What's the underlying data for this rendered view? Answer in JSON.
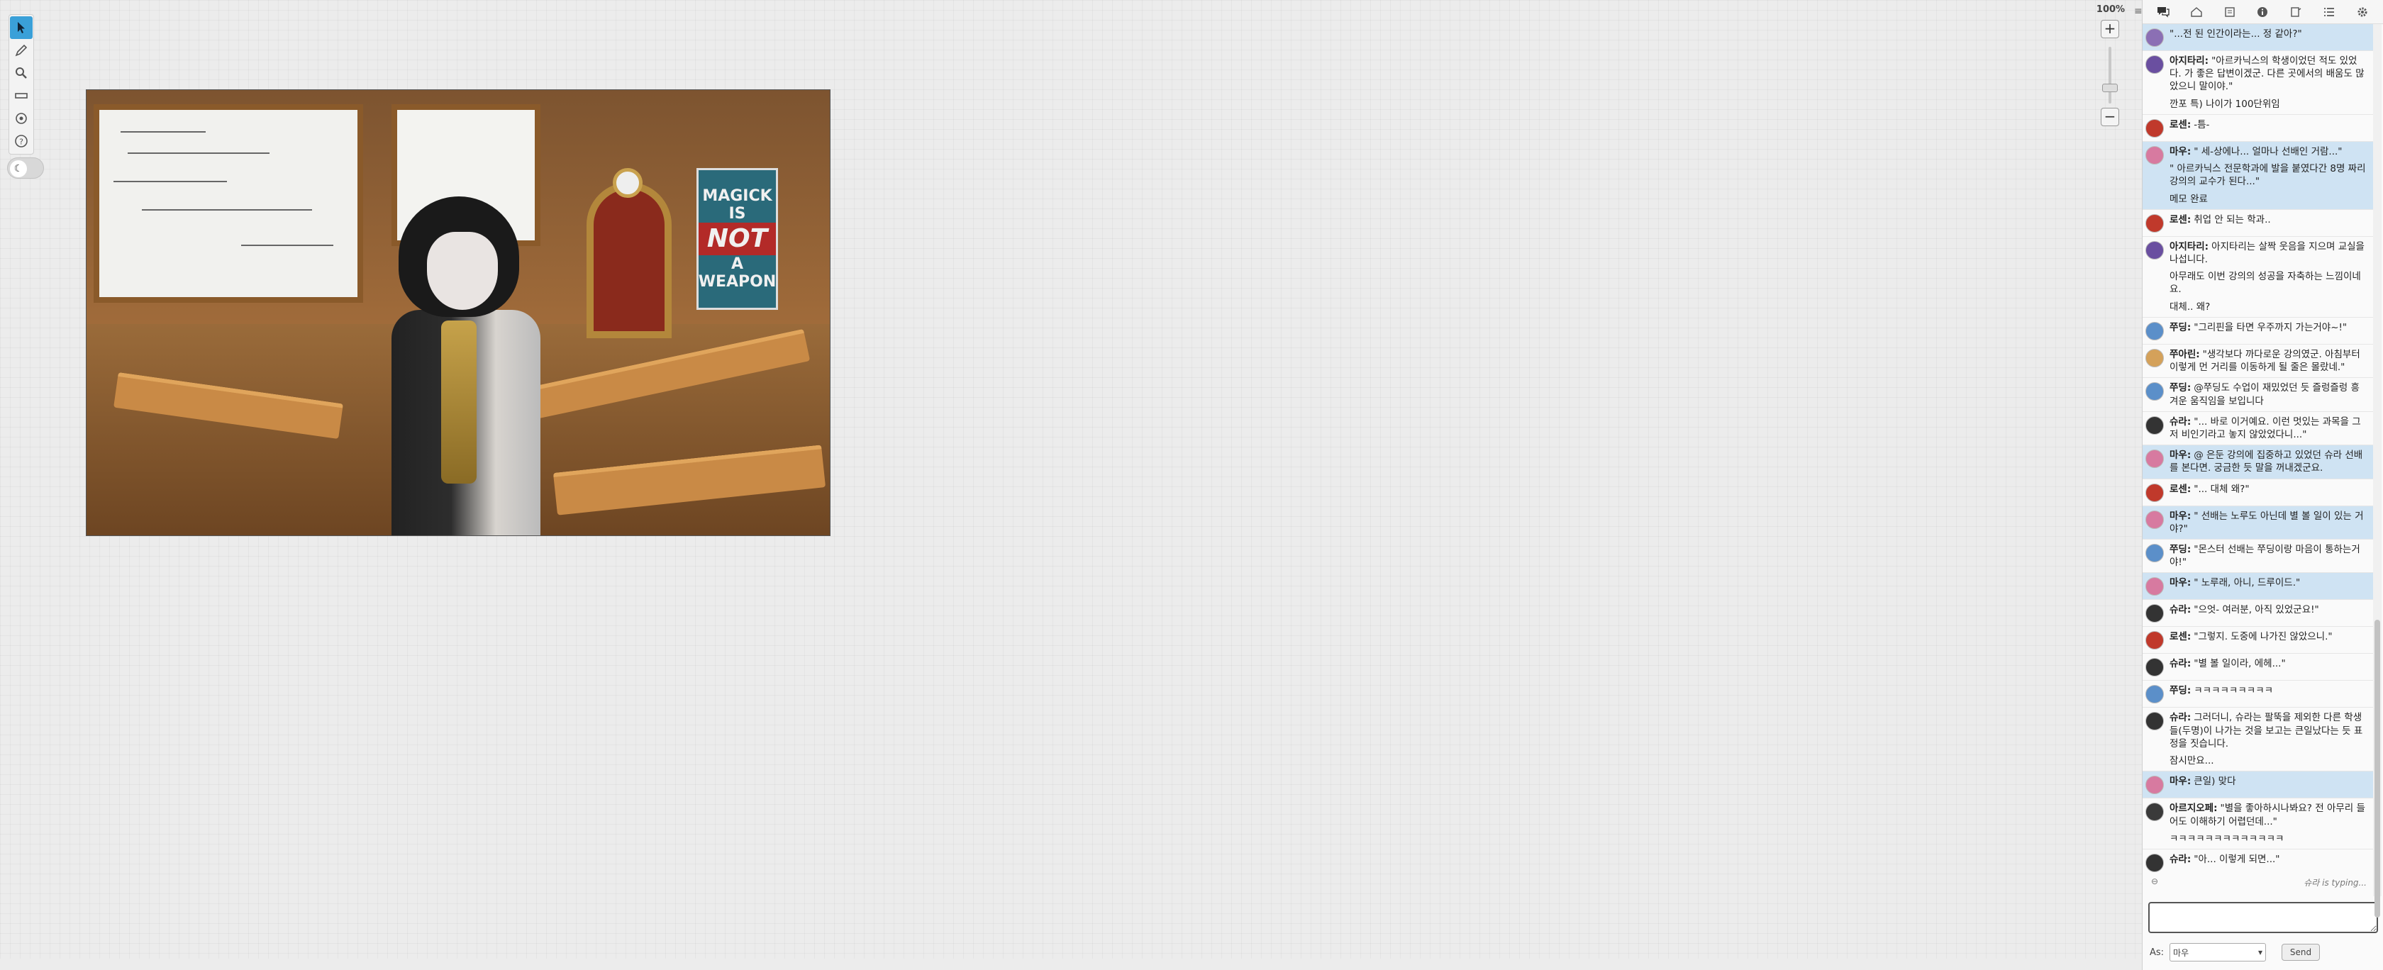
{
  "canvas": {
    "zoom_label": "100%",
    "tools": [
      {
        "name": "select-tool",
        "icon": "cursor-icon"
      },
      {
        "name": "draw-tool",
        "icon": "pencil-icon"
      },
      {
        "name": "zoom-tool",
        "icon": "magnifier-icon"
      },
      {
        "name": "measure-tool",
        "icon": "ruler-icon"
      },
      {
        "name": "fog-tool",
        "icon": "target-icon"
      },
      {
        "name": "help-tool",
        "icon": "question-icon"
      }
    ],
    "night_mode_icon": "moon-icon"
  },
  "scene": {
    "poster_lines": [
      "MAGICK",
      "IS",
      "NOT",
      "A",
      "WEAPON"
    ]
  },
  "panel": {
    "tabs": [
      "chat-icon",
      "art-icon",
      "journal-icon",
      "info-icon",
      "decks-icon",
      "list-icon",
      "settings-icon"
    ],
    "messages": [
      {
        "who": "",
        "text": "\"...전 된 인간이라는... 정 같아?\"",
        "you": true,
        "color": "#8b6fb4"
      },
      {
        "who": "아지타리:",
        "text": "\"아르카닉스의 학생이었던 적도 있었다. 가 좋은 답변이겠군. 다른 곳에서의 배움도 많았으니 말이야.\"",
        "sub": "깐포 특) 나이가 100단위임",
        "you": false,
        "color": "#6a4fa0"
      },
      {
        "who": "로센:",
        "text": "-틈-",
        "you": false,
        "color": "#c0392b"
      },
      {
        "who": "마우:",
        "text": "\" 세-상에나... 얼마나 선배인 거람...\"",
        "sub": "\" 아르카닉스 전문학과에 발을 붙였다간 8명 짜리 강의의 교수가 된다...\"",
        "sub2": "메모 완료",
        "you": true,
        "color": "#d77aa0"
      },
      {
        "who": "로센:",
        "text": "취업 안 되는 학과..",
        "you": false,
        "color": "#c0392b"
      },
      {
        "who": "아지타리:",
        "text": "아지타리는 살짝 웃음을 지으며 교실을 나섭니다.",
        "sub": "아무래도 이번 강의의 성공을 자축하는 느낌이네요.",
        "sub2": "대체.. 왜?",
        "you": false,
        "color": "#6a4fa0"
      },
      {
        "who": "쭈딩:",
        "text": "\"그리핀을 타면 우주까지 가는거야~!\"",
        "you": false,
        "color": "#5b8fc9"
      },
      {
        "who": "쭈아린:",
        "text": "\"생각보다 까다로운 강의였군. 아침부터 이렇게 먼 거리를 이동하게 될 줄은 몰랐네.\"",
        "you": false,
        "color": "#d4a15a"
      },
      {
        "who": "쭈딩:",
        "text": "@쭈딩도 수업이 재밌었던 듯 즐렁즐렁 흥겨운 움직임을 보입니다",
        "you": false,
        "color": "#5b8fc9"
      },
      {
        "who": "슈라:",
        "text": "\"... 바로 이거예요. 이런 멋있는 과목을 그저 비인기라고 놓지 않았었다니...\"",
        "you": false,
        "color": "#333333"
      },
      {
        "who": "마우:",
        "text": "@ 은둔 강의에 집중하고 있었던 슈라 선배를 본다면. 궁금한 듯 말을 꺼내겠군요.",
        "you": true,
        "color": "#d77aa0"
      },
      {
        "who": "로센:",
        "text": "\"... 대체 왜?\"",
        "you": false,
        "color": "#c0392b"
      },
      {
        "who": "마우:",
        "text": "\" 선배는 노루도 아닌데 별 볼 일이 있는 거야?\"",
        "you": true,
        "color": "#d77aa0"
      },
      {
        "who": "쭈딩:",
        "text": "\"몬스터 선배는 쭈딩이랑 마음이 통하는거야!\"",
        "you": false,
        "color": "#5b8fc9"
      },
      {
        "who": "마우:",
        "text": "\" 노루래, 아니, 드루이드.\"",
        "you": true,
        "color": "#d77aa0"
      },
      {
        "who": "슈라:",
        "text": "\"으엇- 여러분, 아직 있었군요!\"",
        "you": false,
        "color": "#333333"
      },
      {
        "who": "로센:",
        "text": "\"그렇지. 도중에 나가진 않았으니.\"",
        "you": false,
        "color": "#c0392b"
      },
      {
        "who": "슈라:",
        "text": "\"별 볼 일이라, 에헤...\"",
        "you": false,
        "color": "#333333"
      },
      {
        "who": "쭈딩:",
        "text": "ㅋㅋㅋㅋㅋㅋㅋㅋㅋ",
        "you": false,
        "color": "#5b8fc9"
      },
      {
        "who": "슈라:",
        "text": "그러더니, 슈라는 팔뚝을 제외한 다른 학생들(두명)이 나가는 것을 보고는 큰일났다는 듯 표정을 짓습니다.",
        "sub": "잠시만요...",
        "you": false,
        "color": "#333333"
      },
      {
        "who": "마우:",
        "text": "큰일) 맞다",
        "you": true,
        "color": "#d77aa0"
      },
      {
        "who": "아르지오페:",
        "text": "\"별을 좋아하시나봐요? 전 아무리 들어도 이해하기 어렵던데...\"",
        "sub": "ㅋㅋㅋㅋㅋㅋㅋㅋㅋㅋㅋㅋㅋ",
        "you": false,
        "color": "#3a3a3a"
      },
      {
        "who": "슈라:",
        "text": "\"아... 이렇게 되면...\"",
        "you": false,
        "color": "#333333"
      }
    ],
    "typing_status": "슈라 is typing...",
    "input_value": "",
    "as_label": "As:",
    "as_selected": "마우",
    "send_label": "Send"
  }
}
